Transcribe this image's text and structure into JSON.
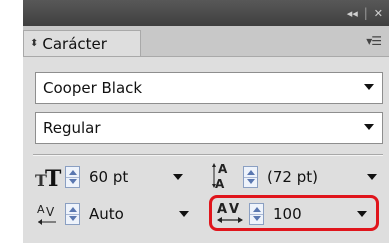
{
  "panel": {
    "tab_label": "Carácter",
    "font_family": "Cooper Black",
    "font_style": "Regular"
  },
  "controls": {
    "font_size": "60 pt",
    "leading": "(72 pt)",
    "kerning": "Auto",
    "tracking": "100"
  },
  "icons": {
    "collapse": "double-chevron-right-icon",
    "close": "close-icon",
    "panel_menu": "panel-menu-icon",
    "tab_chevron": "collapse-toggle-icon",
    "font_size": "font-size-icon",
    "leading": "leading-icon",
    "kerning": "kerning-icon",
    "tracking": "tracking-icon"
  },
  "colors": {
    "highlight": "#e0151c",
    "stepper": "#5a77b0"
  }
}
